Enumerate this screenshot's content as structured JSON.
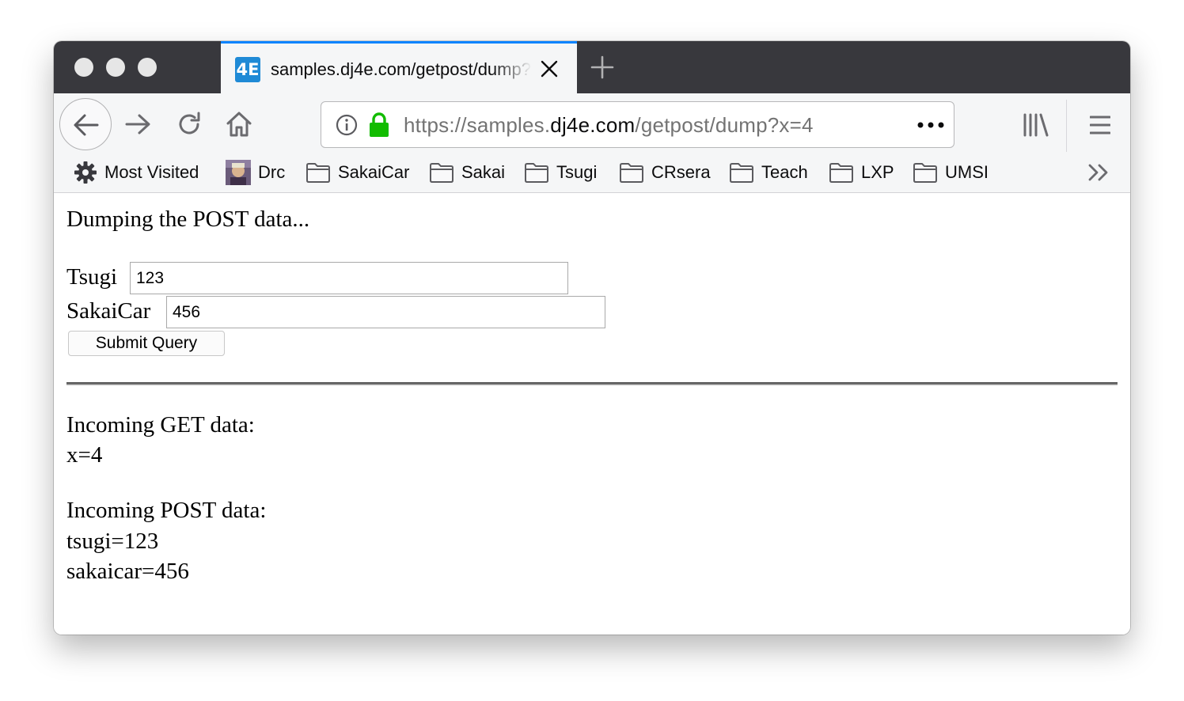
{
  "browser": {
    "tab": {
      "favicon_text": "4E",
      "title": "samples.dj4e.com/getpost/dump?x=4"
    },
    "url": {
      "prefix": "https://samples.",
      "domain": "dj4e.com",
      "path": "/getpost/dump?x=4"
    },
    "bookmarks": [
      {
        "label": "Most Visited",
        "icon": "gear-icon"
      },
      {
        "label": "Drc",
        "icon": "avatar-icon"
      },
      {
        "label": "SakaiCar",
        "icon": "folder-icon"
      },
      {
        "label": "Sakai",
        "icon": "folder-icon"
      },
      {
        "label": "Tsugi",
        "icon": "folder-icon"
      },
      {
        "label": "CRsera",
        "icon": "folder-icon"
      },
      {
        "label": "Teach",
        "icon": "folder-icon"
      },
      {
        "label": "LXP",
        "icon": "folder-icon"
      },
      {
        "label": "UMSI",
        "icon": "folder-icon"
      }
    ],
    "colors": {
      "tab_accent": "#0a84ff",
      "lock_green": "#12bc00",
      "titlebar": "#38383d"
    }
  },
  "page": {
    "heading": "Dumping the POST data...",
    "form": {
      "tsugi_label": "Tsugi",
      "tsugi_value": "123",
      "sakaicar_label": "SakaiCar",
      "sakaicar_value": "456",
      "submit_label": "Submit Query"
    },
    "get_heading": "Incoming GET data:",
    "get_lines": [
      "x=4"
    ],
    "post_heading": "Incoming POST data:",
    "post_lines": [
      "tsugi=123",
      "sakaicar=456"
    ]
  }
}
